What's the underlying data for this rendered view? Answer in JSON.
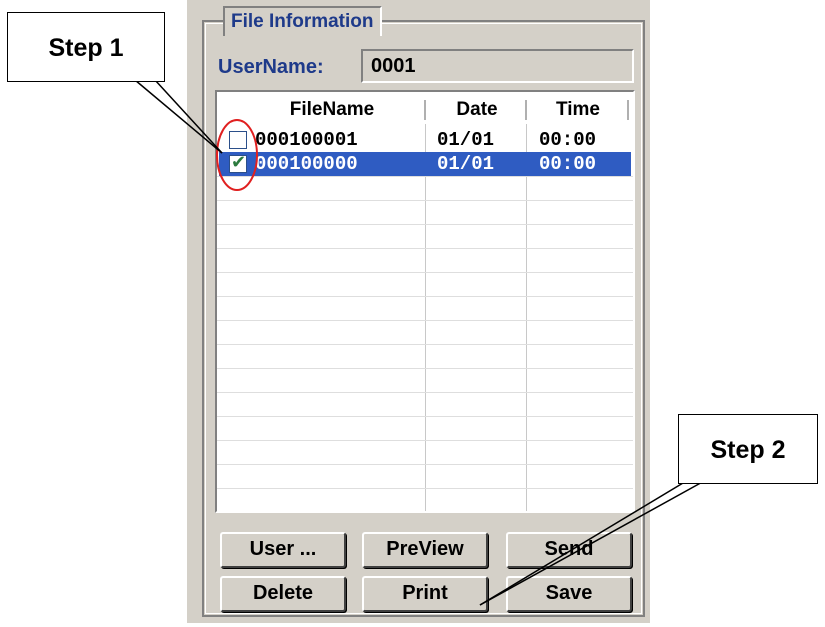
{
  "panel": {
    "title": "File Information",
    "username_label": "UserName:",
    "username_value": "0001"
  },
  "list": {
    "headers": [
      "FileName",
      "Date",
      "Time"
    ],
    "rows": [
      {
        "checked": false,
        "selected": false,
        "filename": "000100001",
        "date": "01/01",
        "time": "00:00"
      },
      {
        "checked": true,
        "selected": true,
        "filename": "000100000",
        "date": "01/01",
        "time": "00:00"
      }
    ]
  },
  "buttons": {
    "user": "User ...",
    "preview": "PreView",
    "send": "Send",
    "delete": "Delete",
    "print": "Print",
    "save": "Save"
  },
  "callouts": {
    "step1": "Step 1",
    "step2": "Step 2"
  },
  "colors": {
    "selection": "#2f5cc2",
    "title_text": "#1e3a8a",
    "annotation_circle": "#e02020"
  }
}
